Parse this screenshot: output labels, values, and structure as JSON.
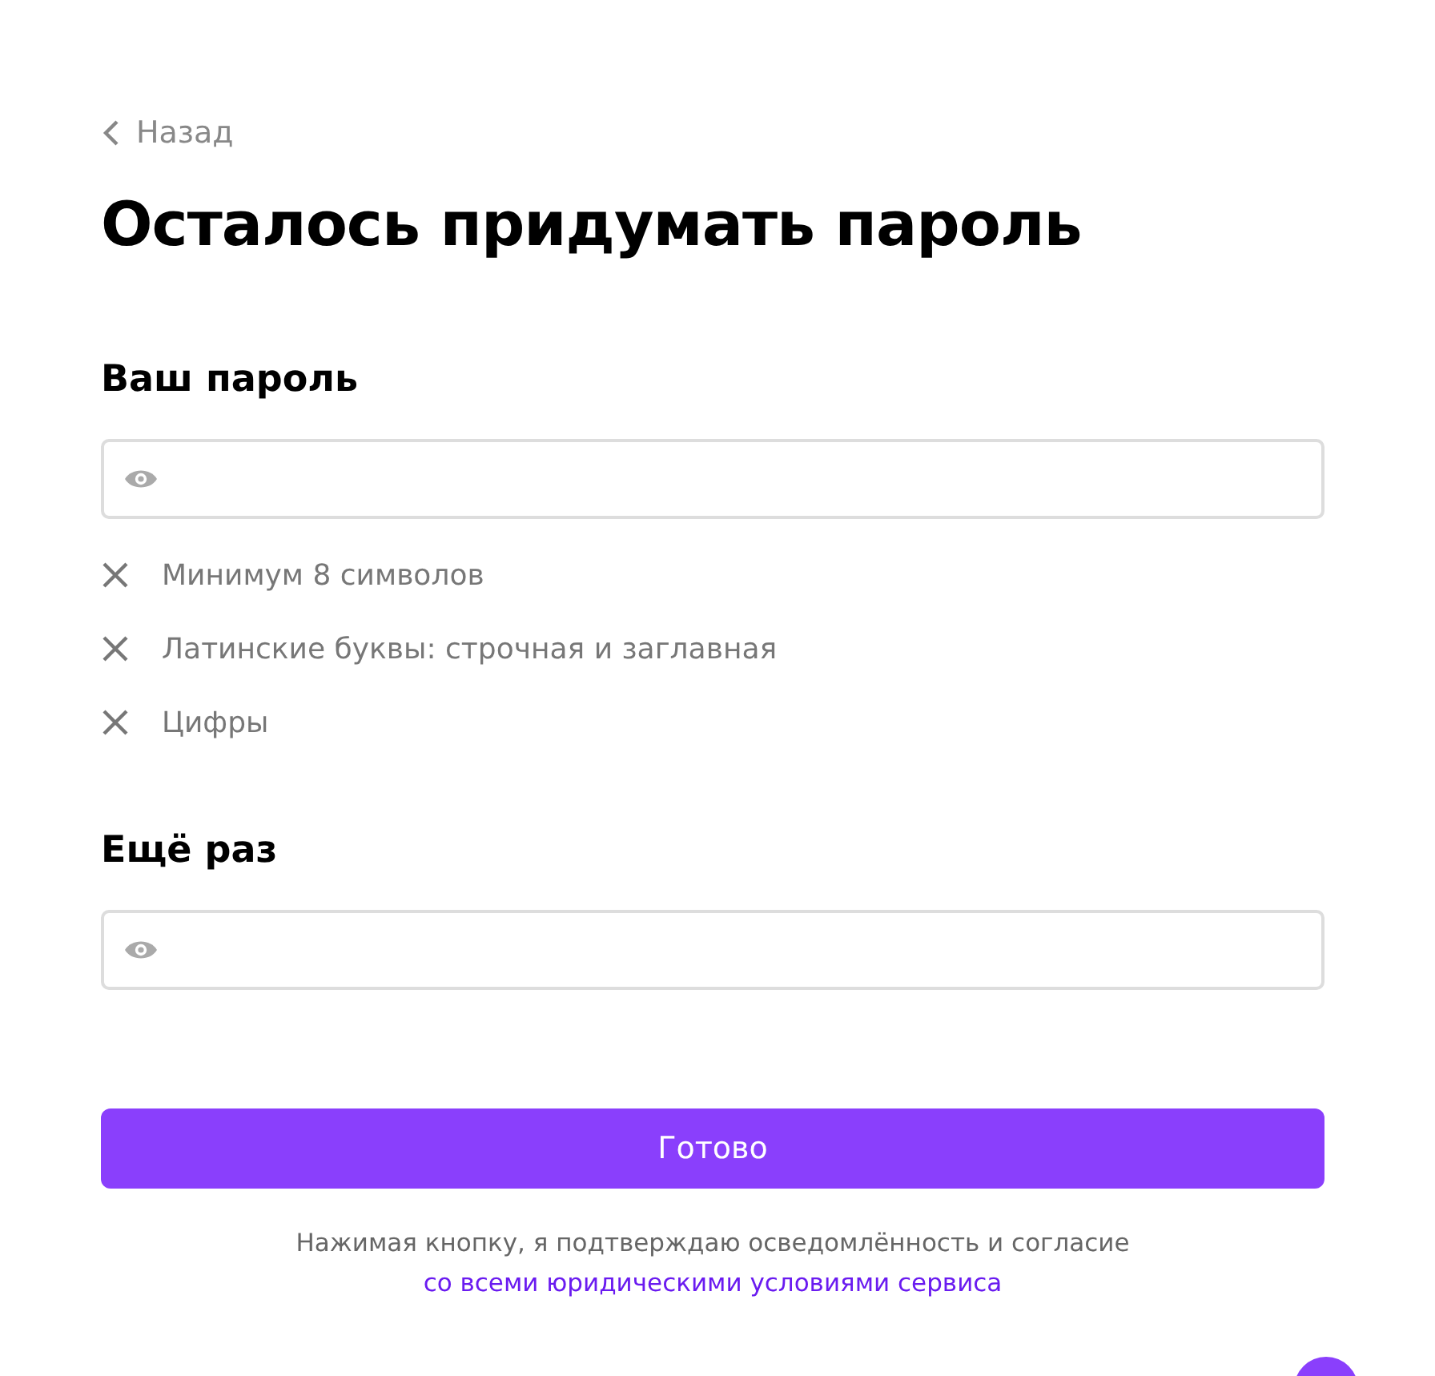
{
  "back_link": "Назад",
  "title": "Осталось придумать пароль",
  "fields": [
    {
      "label": "Ваш пароль"
    },
    {
      "label": "Ещё раз"
    }
  ],
  "rules": [
    {
      "text": "Минимум 8 символов",
      "met": false
    },
    {
      "text": "Латинские буквы: строчная и заглавная",
      "met": false
    },
    {
      "text": "Цифры",
      "met": false
    }
  ],
  "submit_button": "Готово",
  "consent": {
    "text": "Нажимая кнопку, я подтверждаю осведомлённость и согласие",
    "link": "со всеми юридическими условиями сервиса"
  }
}
